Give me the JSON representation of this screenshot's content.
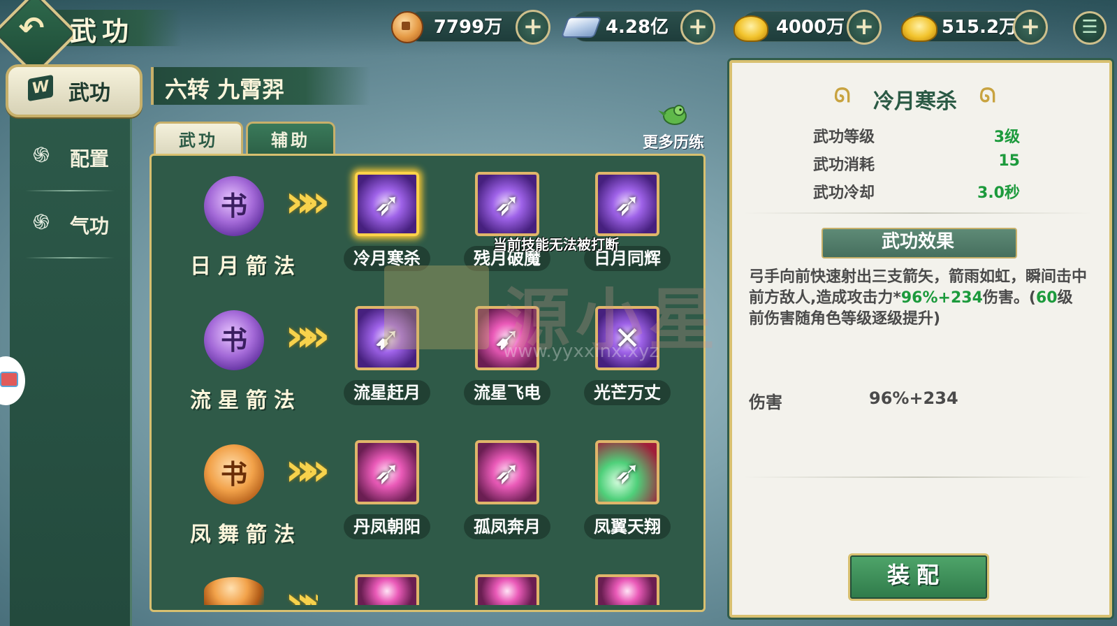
{
  "header": {
    "title": "武功",
    "resources": [
      {
        "name": "copper-coin",
        "value": "7799万"
      },
      {
        "name": "silver-ingot",
        "value": "4.28亿"
      },
      {
        "name": "gold-ingot",
        "value": "4000万"
      },
      {
        "name": "gold-ingot-premium",
        "value": "515.2万"
      }
    ]
  },
  "sidebar": {
    "items": [
      {
        "label": "武功",
        "active": true
      },
      {
        "label": "配置"
      },
      {
        "label": "气功"
      }
    ]
  },
  "section_title": "六转 九霄羿",
  "tabs": [
    {
      "label": "武功",
      "active": true
    },
    {
      "label": "辅助"
    }
  ],
  "more_training": "更多历练",
  "skill_rows": [
    {
      "name": "日月箭法",
      "book_color": "purple",
      "skills": [
        {
          "label": "冷月寒杀",
          "selected": true
        },
        {
          "label": "残月破魔"
        },
        {
          "label": "日月同辉"
        }
      ]
    },
    {
      "name": "流星箭法",
      "book_color": "purple",
      "skills": [
        {
          "label": "流星赶月"
        },
        {
          "label": "流星飞电"
        },
        {
          "label": "光芒万丈"
        }
      ]
    },
    {
      "name": "凤舞箭法",
      "book_color": "orange",
      "skills": [
        {
          "label": "丹凤朝阳"
        },
        {
          "label": "孤凤奔月"
        },
        {
          "label": "凤翼天翔"
        }
      ]
    }
  ],
  "tooltip": "当前技能无法被打断",
  "watermark": {
    "text": "源小星",
    "url": "www.yyxxinx.xyz"
  },
  "detail": {
    "skill_name": "冷月寒杀",
    "stats": [
      {
        "key": "武功等级",
        "value": "3级"
      },
      {
        "key": "武功消耗",
        "value": "15"
      },
      {
        "key": "武功冷却",
        "value": "3.0秒"
      }
    ],
    "effect_title": "武功效果",
    "desc_before": "弓手向前快速射出三支箭矢，箭雨如虹，瞬间击中前方敌人,造成攻击力*",
    "desc_highlight": "96%+234",
    "desc_after": "伤害。(",
    "desc_highlight2": "60",
    "desc_after2": "级前伤害随角色等级逐级提升)",
    "damage_key": "伤害",
    "damage_value": "96%+234",
    "equip_label": "装配"
  },
  "colors": {
    "accent_gold": "#d8c070",
    "panel_green": "#2f5a48",
    "value_green": "#1c9a3c"
  }
}
